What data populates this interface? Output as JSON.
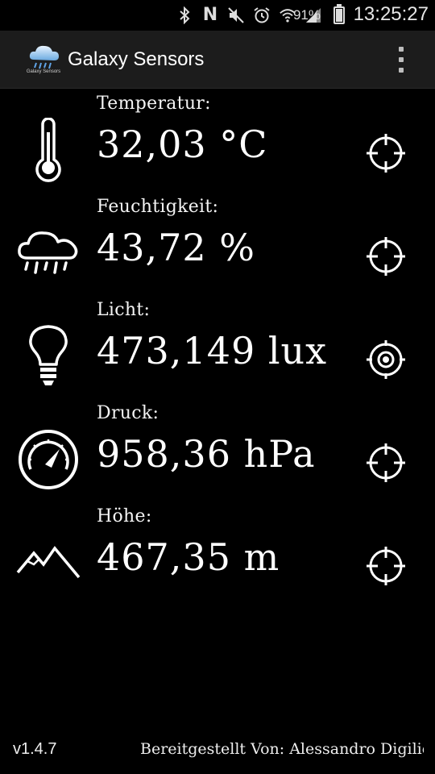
{
  "status_bar": {
    "icons": [
      "bluetooth-icon",
      "nfc-icon",
      "mute-icon",
      "alarm-icon",
      "wifi-icon",
      "signal-icon"
    ],
    "nfc_glyph": "N",
    "battery_percent": "91%",
    "time": "13:25:27"
  },
  "action_bar": {
    "logo_caption": "Galaxy Sensors",
    "title": "Galaxy Sensors",
    "menu_icon": "overflow-menu-icon"
  },
  "sensors": [
    {
      "label": "Temperatur:",
      "value": "32,03 °C",
      "icon": "thermometer-icon",
      "target_state": "inactive"
    },
    {
      "label": "Feuchtigkeit:",
      "value": "43,72 %",
      "icon": "rain-cloud-icon",
      "target_state": "inactive"
    },
    {
      "label": "Licht:",
      "value": "473,149 lux",
      "icon": "lightbulb-icon",
      "target_state": "active"
    },
    {
      "label": "Druck:",
      "value": "958,36 hPa",
      "icon": "barometer-icon",
      "target_state": "inactive"
    },
    {
      "label": "Höhe:",
      "value": "467,35 m",
      "icon": "mountains-icon",
      "target_state": "inactive"
    }
  ],
  "footer": {
    "version": "v1.4.7",
    "credits": "Bereitgestellt Von: Alessandro Digilio"
  },
  "colors": {
    "background": "#000000",
    "action_bar": "#1c1c1c",
    "foreground": "#ffffff"
  }
}
